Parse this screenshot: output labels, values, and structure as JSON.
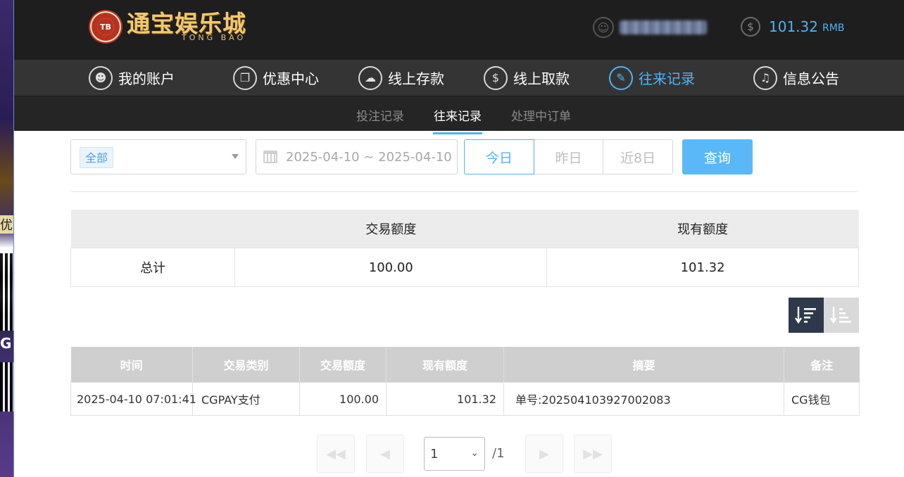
{
  "header": {
    "logo_cn": "通宝娱乐城",
    "logo_en": "TONG BAO",
    "logo_badge": "TB",
    "balance_value": "101.32",
    "balance_unit": "RMB"
  },
  "main_nav": [
    {
      "label": "我的账户",
      "icon": "user-icon",
      "active": false
    },
    {
      "label": "优惠中心",
      "icon": "gift-icon",
      "active": false
    },
    {
      "label": "线上存款",
      "icon": "deposit-icon",
      "active": false
    },
    {
      "label": "线上取款",
      "icon": "withdraw-icon",
      "active": false
    },
    {
      "label": "往来记录",
      "icon": "records-icon",
      "active": true
    },
    {
      "label": "信息公告",
      "icon": "bell-icon",
      "active": false
    }
  ],
  "sub_nav": [
    {
      "label": "投注记录",
      "active": false
    },
    {
      "label": "往来记录",
      "active": true
    },
    {
      "label": "处理中订单",
      "active": false
    }
  ],
  "filters": {
    "type_selected": "全部",
    "date_range": "2025-04-10 ~ 2025-04-10",
    "today": "今日",
    "yesterday": "昨日",
    "last8": "近8日",
    "query": "查询"
  },
  "summary": {
    "headers": [
      "",
      "交易额度",
      "现有额度"
    ],
    "total_label": "总计",
    "total_amount": "100.00",
    "total_balance": "101.32"
  },
  "records": {
    "headers": [
      "时间",
      "交易类别",
      "交易额度",
      "现有额度",
      "摘要",
      "备注"
    ],
    "rows": [
      [
        "2025-04-10 07:01:41",
        "CGPAY支付",
        "100.00",
        "101.32",
        "单号:202504103927002083",
        "CG钱包"
      ]
    ]
  },
  "pager": {
    "current": "1",
    "total": "/1"
  },
  "colors": {
    "accent": "#4fb3f5",
    "header_bg": "#1e1e1e",
    "nav_bg": "#343434",
    "subnav_bg": "#252525"
  }
}
